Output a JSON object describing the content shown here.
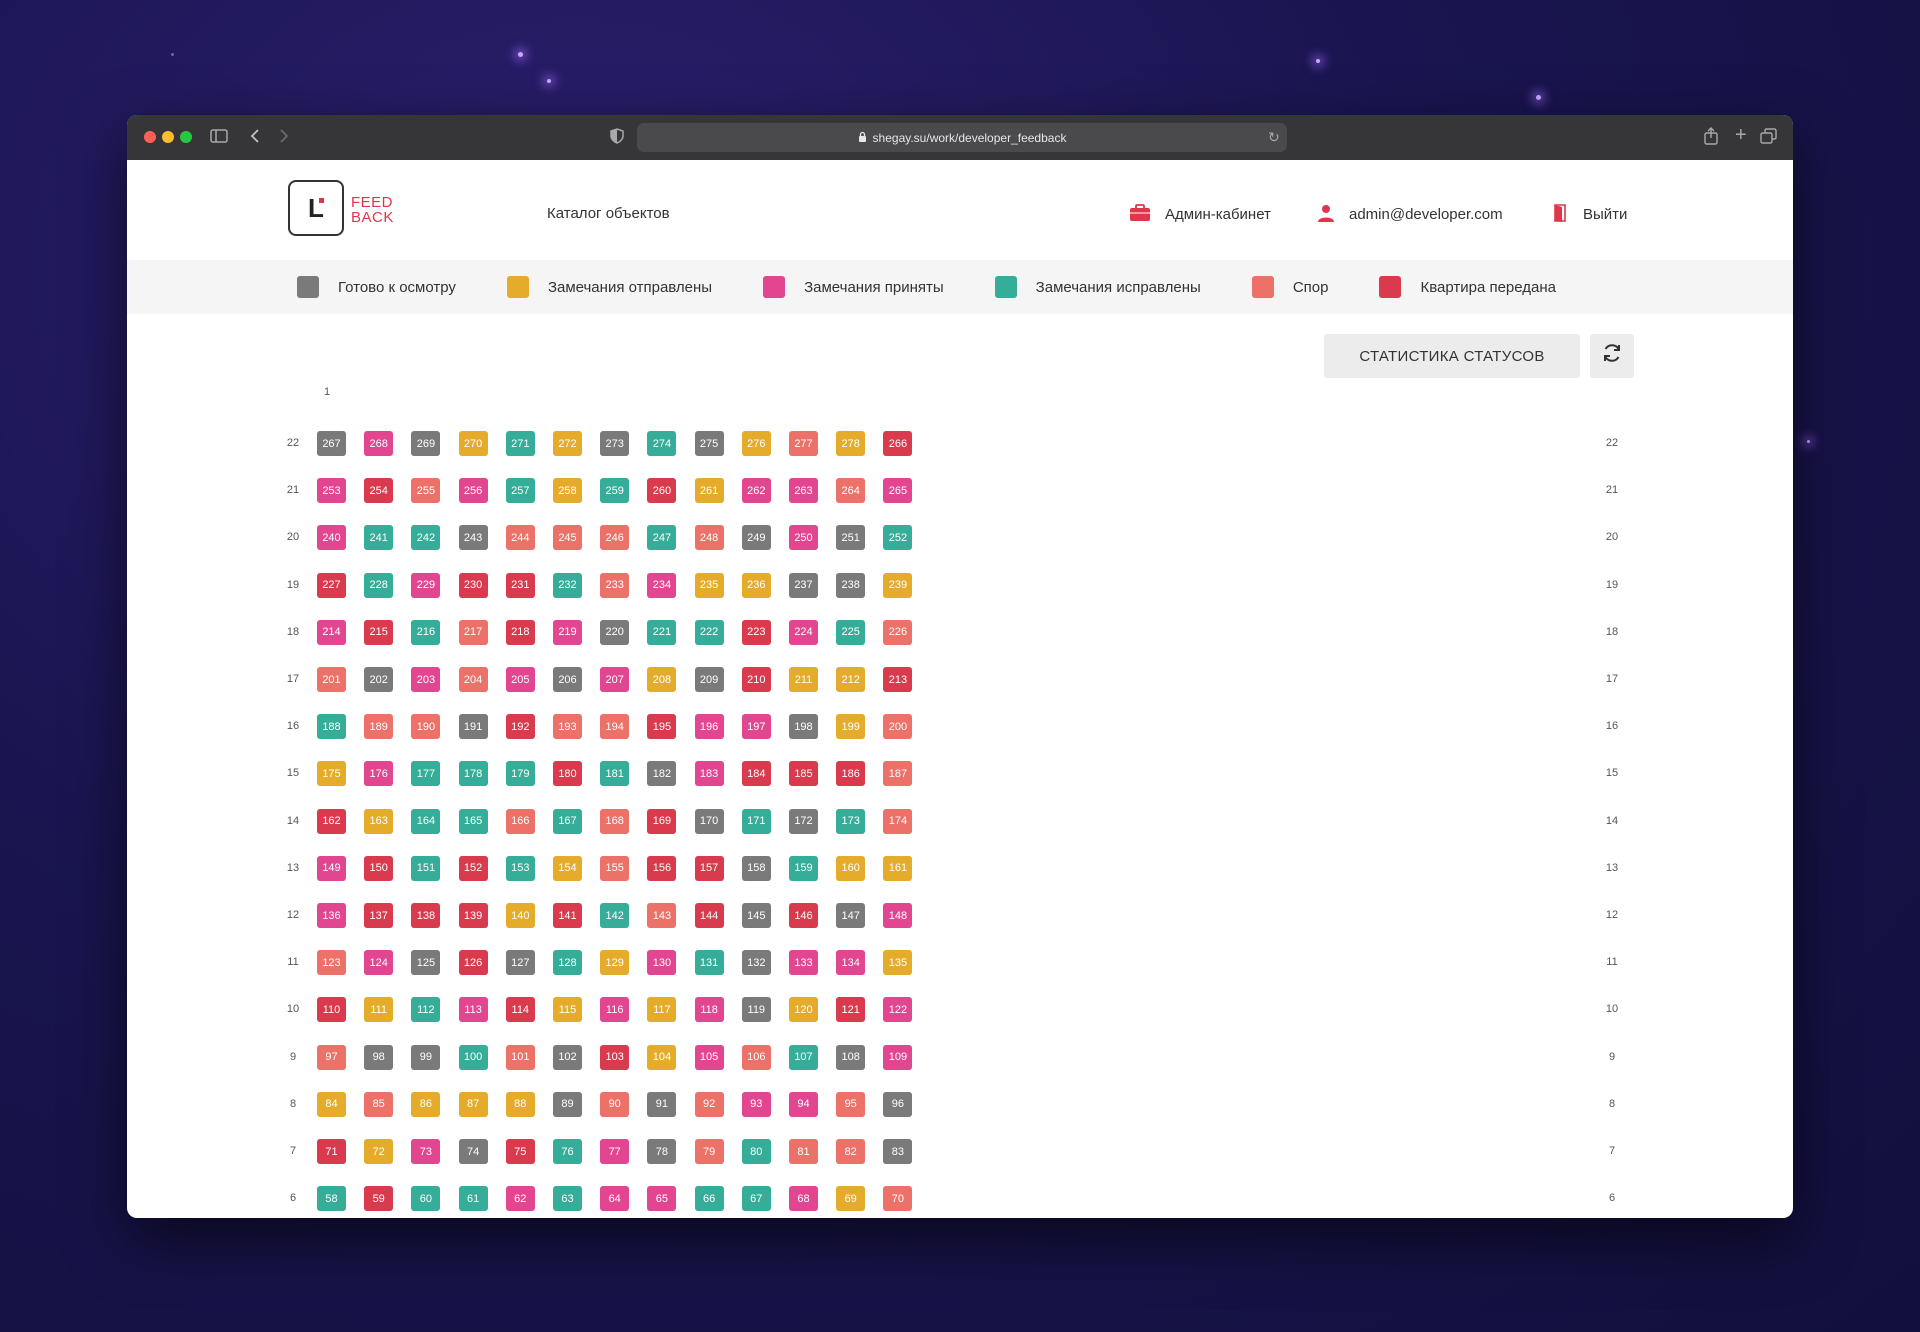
{
  "browser": {
    "url": "shegay.su/work/developer_feedback"
  },
  "header": {
    "logo_letter": "L",
    "logo_line1": "FEED",
    "logo_line2": "BACK",
    "catalog_label": "Каталог объектов",
    "admin_label": "Админ-кабинет",
    "user_email": "admin@developer.com",
    "logout_label": "Выйти"
  },
  "colors": {
    "gray": "#7a7a7a",
    "yellow": "#e5ac2c",
    "pink": "#e24690",
    "teal": "#36ad98",
    "salmon": "#ec7168",
    "red": "#d93a4e"
  },
  "legend": [
    {
      "label": "Готово к осмотру",
      "color": "#7a7a7a"
    },
    {
      "label": "Замечания отправлены",
      "color": "#e5ac2c"
    },
    {
      "label": "Замечания приняты",
      "color": "#e24690"
    },
    {
      "label": "Замечания исправлены",
      "color": "#36ad98"
    },
    {
      "label": "Спор",
      "color": "#ec7168"
    },
    {
      "label": "Квартира передана",
      "color": "#d93a4e"
    }
  ],
  "toolbar": {
    "stats_label": "СТАТИСТИКА СТАТУСОВ",
    "refresh_icon": "refresh-icon"
  },
  "building": {
    "section": "1",
    "floors": [
      {
        "floor": "22",
        "apts": [
          [
            "267",
            "gray"
          ],
          [
            "268",
            "pink"
          ],
          [
            "269",
            "gray"
          ],
          [
            "270",
            "yellow"
          ],
          [
            "271",
            "teal"
          ],
          [
            "272",
            "yellow"
          ],
          [
            "273",
            "gray"
          ],
          [
            "274",
            "teal"
          ],
          [
            "275",
            "gray"
          ],
          [
            "276",
            "yellow"
          ],
          [
            "277",
            "salmon"
          ],
          [
            "278",
            "yellow"
          ],
          [
            "266",
            "red"
          ]
        ]
      },
      {
        "floor": "21",
        "apts": [
          [
            "253",
            "pink"
          ],
          [
            "254",
            "red"
          ],
          [
            "255",
            "salmon"
          ],
          [
            "256",
            "pink"
          ],
          [
            "257",
            "teal"
          ],
          [
            "258",
            "yellow"
          ],
          [
            "259",
            "teal"
          ],
          [
            "260",
            "red"
          ],
          [
            "261",
            "yellow"
          ],
          [
            "262",
            "pink"
          ],
          [
            "263",
            "pink"
          ],
          [
            "264",
            "salmon"
          ],
          [
            "265",
            "pink"
          ]
        ]
      },
      {
        "floor": "20",
        "apts": [
          [
            "240",
            "pink"
          ],
          [
            "241",
            "teal"
          ],
          [
            "242",
            "teal"
          ],
          [
            "243",
            "gray"
          ],
          [
            "244",
            "salmon"
          ],
          [
            "245",
            "salmon"
          ],
          [
            "246",
            "salmon"
          ],
          [
            "247",
            "teal"
          ],
          [
            "248",
            "salmon"
          ],
          [
            "249",
            "gray"
          ],
          [
            "250",
            "pink"
          ],
          [
            "251",
            "gray"
          ],
          [
            "252",
            "teal"
          ]
        ]
      },
      {
        "floor": "19",
        "apts": [
          [
            "227",
            "red"
          ],
          [
            "228",
            "teal"
          ],
          [
            "229",
            "pink"
          ],
          [
            "230",
            "red"
          ],
          [
            "231",
            "red"
          ],
          [
            "232",
            "teal"
          ],
          [
            "233",
            "salmon"
          ],
          [
            "234",
            "pink"
          ],
          [
            "235",
            "yellow"
          ],
          [
            "236",
            "yellow"
          ],
          [
            "237",
            "gray"
          ],
          [
            "238",
            "gray"
          ],
          [
            "239",
            "yellow"
          ]
        ]
      },
      {
        "floor": "18",
        "apts": [
          [
            "214",
            "pink"
          ],
          [
            "215",
            "red"
          ],
          [
            "216",
            "teal"
          ],
          [
            "217",
            "salmon"
          ],
          [
            "218",
            "red"
          ],
          [
            "219",
            "pink"
          ],
          [
            "220",
            "gray"
          ],
          [
            "221",
            "teal"
          ],
          [
            "222",
            "teal"
          ],
          [
            "223",
            "red"
          ],
          [
            "224",
            "pink"
          ],
          [
            "225",
            "teal"
          ],
          [
            "226",
            "salmon"
          ]
        ]
      },
      {
        "floor": "17",
        "apts": [
          [
            "201",
            "salmon"
          ],
          [
            "202",
            "gray"
          ],
          [
            "203",
            "pink"
          ],
          [
            "204",
            "salmon"
          ],
          [
            "205",
            "pink"
          ],
          [
            "206",
            "gray"
          ],
          [
            "207",
            "pink"
          ],
          [
            "208",
            "yellow"
          ],
          [
            "209",
            "gray"
          ],
          [
            "210",
            "red"
          ],
          [
            "211",
            "yellow"
          ],
          [
            "212",
            "yellow"
          ],
          [
            "213",
            "red"
          ]
        ]
      },
      {
        "floor": "16",
        "apts": [
          [
            "188",
            "teal"
          ],
          [
            "189",
            "salmon"
          ],
          [
            "190",
            "salmon"
          ],
          [
            "191",
            "gray"
          ],
          [
            "192",
            "red"
          ],
          [
            "193",
            "salmon"
          ],
          [
            "194",
            "salmon"
          ],
          [
            "195",
            "red"
          ],
          [
            "196",
            "pink"
          ],
          [
            "197",
            "pink"
          ],
          [
            "198",
            "gray"
          ],
          [
            "199",
            "yellow"
          ],
          [
            "200",
            "salmon"
          ]
        ]
      },
      {
        "floor": "15",
        "apts": [
          [
            "175",
            "yellow"
          ],
          [
            "176",
            "pink"
          ],
          [
            "177",
            "teal"
          ],
          [
            "178",
            "teal"
          ],
          [
            "179",
            "teal"
          ],
          [
            "180",
            "red"
          ],
          [
            "181",
            "teal"
          ],
          [
            "182",
            "gray"
          ],
          [
            "183",
            "pink"
          ],
          [
            "184",
            "red"
          ],
          [
            "185",
            "red"
          ],
          [
            "186",
            "red"
          ],
          [
            "187",
            "salmon"
          ]
        ]
      },
      {
        "floor": "14",
        "apts": [
          [
            "162",
            "red"
          ],
          [
            "163",
            "yellow"
          ],
          [
            "164",
            "teal"
          ],
          [
            "165",
            "teal"
          ],
          [
            "166",
            "salmon"
          ],
          [
            "167",
            "teal"
          ],
          [
            "168",
            "salmon"
          ],
          [
            "169",
            "red"
          ],
          [
            "170",
            "gray"
          ],
          [
            "171",
            "teal"
          ],
          [
            "172",
            "gray"
          ],
          [
            "173",
            "teal"
          ],
          [
            "174",
            "salmon"
          ]
        ]
      },
      {
        "floor": "13",
        "apts": [
          [
            "149",
            "pink"
          ],
          [
            "150",
            "red"
          ],
          [
            "151",
            "teal"
          ],
          [
            "152",
            "red"
          ],
          [
            "153",
            "teal"
          ],
          [
            "154",
            "yellow"
          ],
          [
            "155",
            "salmon"
          ],
          [
            "156",
            "red"
          ],
          [
            "157",
            "red"
          ],
          [
            "158",
            "gray"
          ],
          [
            "159",
            "teal"
          ],
          [
            "160",
            "yellow"
          ],
          [
            "161",
            "yellow"
          ]
        ]
      },
      {
        "floor": "12",
        "apts": [
          [
            "136",
            "pink"
          ],
          [
            "137",
            "red"
          ],
          [
            "138",
            "red"
          ],
          [
            "139",
            "red"
          ],
          [
            "140",
            "yellow"
          ],
          [
            "141",
            "red"
          ],
          [
            "142",
            "teal"
          ],
          [
            "143",
            "salmon"
          ],
          [
            "144",
            "red"
          ],
          [
            "145",
            "gray"
          ],
          [
            "146",
            "red"
          ],
          [
            "147",
            "gray"
          ],
          [
            "148",
            "pink"
          ]
        ]
      },
      {
        "floor": "11",
        "apts": [
          [
            "123",
            "salmon"
          ],
          [
            "124",
            "pink"
          ],
          [
            "125",
            "gray"
          ],
          [
            "126",
            "red"
          ],
          [
            "127",
            "gray"
          ],
          [
            "128",
            "teal"
          ],
          [
            "129",
            "yellow"
          ],
          [
            "130",
            "pink"
          ],
          [
            "131",
            "teal"
          ],
          [
            "132",
            "gray"
          ],
          [
            "133",
            "pink"
          ],
          [
            "134",
            "pink"
          ],
          [
            "135",
            "yellow"
          ]
        ]
      },
      {
        "floor": "10",
        "apts": [
          [
            "110",
            "red"
          ],
          [
            "111",
            "yellow"
          ],
          [
            "112",
            "teal"
          ],
          [
            "113",
            "pink"
          ],
          [
            "114",
            "red"
          ],
          [
            "115",
            "yellow"
          ],
          [
            "116",
            "pink"
          ],
          [
            "117",
            "yellow"
          ],
          [
            "118",
            "pink"
          ],
          [
            "119",
            "gray"
          ],
          [
            "120",
            "yellow"
          ],
          [
            "121",
            "red"
          ],
          [
            "122",
            "pink"
          ]
        ]
      },
      {
        "floor": "9",
        "apts": [
          [
            "97",
            "salmon"
          ],
          [
            "98",
            "gray"
          ],
          [
            "99",
            "gray"
          ],
          [
            "100",
            "teal"
          ],
          [
            "101",
            "salmon"
          ],
          [
            "102",
            "gray"
          ],
          [
            "103",
            "red"
          ],
          [
            "104",
            "yellow"
          ],
          [
            "105",
            "pink"
          ],
          [
            "106",
            "salmon"
          ],
          [
            "107",
            "teal"
          ],
          [
            "108",
            "gray"
          ],
          [
            "109",
            "pink"
          ]
        ]
      },
      {
        "floor": "8",
        "apts": [
          [
            "84",
            "yellow"
          ],
          [
            "85",
            "salmon"
          ],
          [
            "86",
            "yellow"
          ],
          [
            "87",
            "yellow"
          ],
          [
            "88",
            "yellow"
          ],
          [
            "89",
            "gray"
          ],
          [
            "90",
            "salmon"
          ],
          [
            "91",
            "gray"
          ],
          [
            "92",
            "salmon"
          ],
          [
            "93",
            "pink"
          ],
          [
            "94",
            "pink"
          ],
          [
            "95",
            "salmon"
          ],
          [
            "96",
            "gray"
          ]
        ]
      },
      {
        "floor": "7",
        "apts": [
          [
            "71",
            "red"
          ],
          [
            "72",
            "yellow"
          ],
          [
            "73",
            "pink"
          ],
          [
            "74",
            "gray"
          ],
          [
            "75",
            "red"
          ],
          [
            "76",
            "teal"
          ],
          [
            "77",
            "pink"
          ],
          [
            "78",
            "gray"
          ],
          [
            "79",
            "salmon"
          ],
          [
            "80",
            "teal"
          ],
          [
            "81",
            "salmon"
          ],
          [
            "82",
            "salmon"
          ],
          [
            "83",
            "gray"
          ]
        ]
      },
      {
        "floor": "6",
        "apts": [
          [
            "58",
            "teal"
          ],
          [
            "59",
            "red"
          ],
          [
            "60",
            "teal"
          ],
          [
            "61",
            "teal"
          ],
          [
            "62",
            "pink"
          ],
          [
            "63",
            "teal"
          ],
          [
            "64",
            "pink"
          ],
          [
            "65",
            "pink"
          ],
          [
            "66",
            "teal"
          ],
          [
            "67",
            "teal"
          ],
          [
            "68",
            "pink"
          ],
          [
            "69",
            "yellow"
          ],
          [
            "70",
            "salmon"
          ]
        ]
      }
    ]
  }
}
